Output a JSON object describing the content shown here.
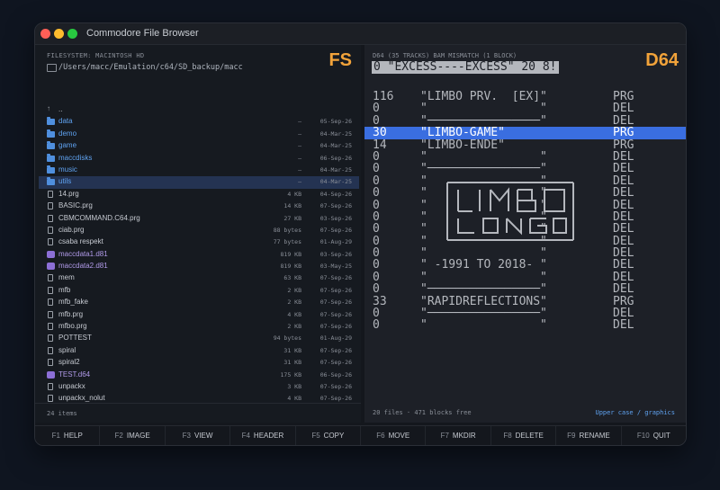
{
  "window": {
    "title": "Commodore File Browser"
  },
  "left_panel": {
    "caption": "FILESYSTEM: MACINTOSH HD",
    "path": "/Users/macc/Emulation/c64/SD_backup/macc",
    "badge": "FS",
    "footer": "24 items",
    "entries": [
      {
        "name": "..",
        "type": "up",
        "size": "",
        "date": ""
      },
      {
        "name": "data",
        "type": "dir",
        "size": "—",
        "date": "05-Sep-26"
      },
      {
        "name": "demo",
        "type": "dir",
        "size": "—",
        "date": "04-Mar-25"
      },
      {
        "name": "game",
        "type": "dir",
        "size": "—",
        "date": "04-Mar-25"
      },
      {
        "name": "maccdisks",
        "type": "dir",
        "size": "—",
        "date": "06-Sep-26"
      },
      {
        "name": "music",
        "type": "dir",
        "size": "—",
        "date": "04-Mar-25"
      },
      {
        "name": "utils",
        "type": "dir",
        "size": "—",
        "date": "04-Mar-25",
        "selected": true
      },
      {
        "name": "14.prg",
        "type": "file",
        "size": "4 KB",
        "date": "04-Sep-26"
      },
      {
        "name": "BASIC.prg",
        "type": "file",
        "size": "14 KB",
        "date": "07-Sep-26"
      },
      {
        "name": "CBMCOMMAND.C64.prg",
        "type": "file",
        "size": "27 KB",
        "date": "03-Sep-26"
      },
      {
        "name": "ciab.prg",
        "type": "file",
        "size": "88 bytes",
        "date": "07-Sep-26"
      },
      {
        "name": "csaba respekt",
        "type": "file",
        "size": "77 bytes",
        "date": "01-Aug-29"
      },
      {
        "name": "maccdata1.d81",
        "type": "disk",
        "size": "819 KB",
        "date": "03-Sep-26"
      },
      {
        "name": "maccdata2.d81",
        "type": "disk",
        "size": "819 KB",
        "date": "03-May-25"
      },
      {
        "name": "mem",
        "type": "file",
        "size": "63 KB",
        "date": "07-Sep-26"
      },
      {
        "name": "mfb",
        "type": "file",
        "size": "2 KB",
        "date": "07-Sep-26"
      },
      {
        "name": "mfb_fake",
        "type": "file",
        "size": "2 KB",
        "date": "07-Sep-26"
      },
      {
        "name": "mfb.prg",
        "type": "file",
        "size": "4 KB",
        "date": "07-Sep-26"
      },
      {
        "name": "mfbo.prg",
        "type": "file",
        "size": "2 KB",
        "date": "07-Sep-26"
      },
      {
        "name": "POTTEST",
        "type": "file",
        "size": "94 bytes",
        "date": "01-Aug-29"
      },
      {
        "name": "spiral",
        "type": "file",
        "size": "31 KB",
        "date": "07-Sep-26"
      },
      {
        "name": "spiral2",
        "type": "file",
        "size": "31 KB",
        "date": "07-Sep-26"
      },
      {
        "name": "TEST.d64",
        "type": "disk",
        "size": "175 KB",
        "date": "06-Sep-26"
      },
      {
        "name": "unpackx",
        "type": "file",
        "size": "3 KB",
        "date": "07-Sep-26"
      },
      {
        "name": "unpackx_nolut",
        "type": "file",
        "size": "4 KB",
        "date": "07-Sep-26"
      }
    ]
  },
  "right_panel": {
    "caption": "D64 (35 TRACKS)  BAM MISMATCH (1 BLOCK)",
    "badge": "D64",
    "disk_header": "0 \"EXCESS----EXCESS\" 20 8!",
    "footer_left": "20 files · 471 blocks free",
    "footer_right": "Upper case / graphics",
    "entries": [
      {
        "blocks": "116",
        "name": "\"LIMBO PRV.  [EX]\"",
        "type": "PRG"
      },
      {
        "blocks": "0",
        "name": "\"                \"",
        "type": "DEL"
      },
      {
        "blocks": "0",
        "name": "\"────────────────\"",
        "type": "DEL"
      },
      {
        "blocks": "30",
        "name": "\"LIMBO-GAME\"",
        "type": "PRG",
        "selected": true
      },
      {
        "blocks": "14",
        "name": "\"LIMBO-ENDE\"",
        "type": "PRG"
      },
      {
        "blocks": "0",
        "name": "\"                \"",
        "type": "DEL"
      },
      {
        "blocks": "0",
        "name": "\"────────────────\"",
        "type": "DEL"
      },
      {
        "blocks": "0",
        "name": "\"                \"",
        "type": "DEL"
      },
      {
        "blocks": "0",
        "name": "\"                \"",
        "type": "DEL"
      },
      {
        "blocks": "0",
        "name": "\"                \"",
        "type": "DEL"
      },
      {
        "blocks": "0",
        "name": "\"                \"",
        "type": "DEL"
      },
      {
        "blocks": "0",
        "name": "\"                \"",
        "type": "DEL"
      },
      {
        "blocks": "0",
        "name": "\"                \"",
        "type": "DEL"
      },
      {
        "blocks": "0",
        "name": "\"                \"",
        "type": "DEL"
      },
      {
        "blocks": "0",
        "name": "\" -1991 TO 2018- \"",
        "type": "DEL"
      },
      {
        "blocks": "0",
        "name": "\"                \"",
        "type": "DEL"
      },
      {
        "blocks": "0",
        "name": "\"────────────────\"",
        "type": "DEL"
      },
      {
        "blocks": "33",
        "name": "\"RAPIDREFLECTIONS\"",
        "type": "PRG"
      },
      {
        "blocks": "0",
        "name": "\"────────────────\"",
        "type": "DEL"
      },
      {
        "blocks": "0",
        "name": "\"                \"",
        "type": "DEL"
      }
    ]
  },
  "function_keys": [
    {
      "key": "F1",
      "label": "HELP"
    },
    {
      "key": "F2",
      "label": "IMAGE"
    },
    {
      "key": "F3",
      "label": "VIEW"
    },
    {
      "key": "F4",
      "label": "HEADER"
    },
    {
      "key": "F5",
      "label": "COPY"
    },
    {
      "key": "F6",
      "label": "MOVE"
    },
    {
      "key": "F7",
      "label": "MKDIR"
    },
    {
      "key": "F8",
      "label": "DELETE"
    },
    {
      "key": "F9",
      "label": "RENAME"
    },
    {
      "key": "F10",
      "label": "QUIT"
    }
  ],
  "colors": {
    "accent_badge": "#f2a33a",
    "selection_right": "#3a6ee0",
    "selection_left": "#243352",
    "folder": "#4f8fde",
    "disk_image": "#8c6fd6"
  }
}
